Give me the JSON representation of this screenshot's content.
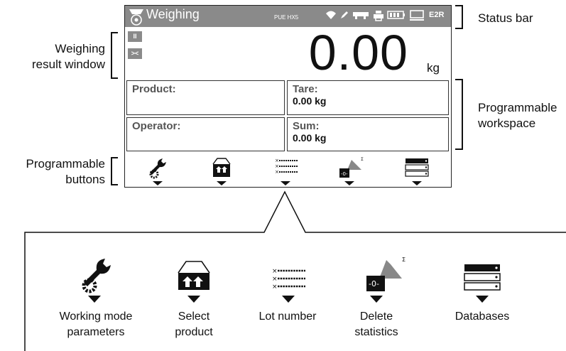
{
  "callouts": {
    "status_bar": "Status bar",
    "weighing_result_window_line1": "Weighing",
    "weighing_result_window_line2": "result window",
    "programmable_workspace_line1": "Programmable",
    "programmable_workspace_line2": "workspace",
    "programmable_buttons_line1": "Programmable",
    "programmable_buttons_line2": "buttons"
  },
  "screen": {
    "status": {
      "title": "Weighing",
      "model": "PUE HX5",
      "code": "E2R",
      "icons": [
        "weighing-mode-icon",
        "wifi-icon",
        "pen-icon",
        "scanner-icon",
        "printer-icon",
        "battery-icon",
        "computer-icon"
      ]
    },
    "small_buttons": [
      "II",
      "><"
    ],
    "weight": {
      "value": "0.00",
      "unit": "kg"
    },
    "fields": {
      "product_label": "Product:",
      "product_value": "",
      "tare_label": "Tare:",
      "tare_value": "0.00 kg",
      "operator_label": "Operator:",
      "operator_value": "",
      "sum_label": "Sum:",
      "sum_value": "0.00 kg"
    },
    "buttons": [
      "working-mode-parameters-icon",
      "select-product-icon",
      "lot-number-icon",
      "delete-statistics-icon",
      "databases-icon"
    ]
  },
  "legend": [
    {
      "icon": "working-mode-parameters-icon",
      "line1": "Working mode",
      "line2": "parameters"
    },
    {
      "icon": "select-product-icon",
      "line1": "Select",
      "line2": "product"
    },
    {
      "icon": "lot-number-icon",
      "line1": "Lot number",
      "line2": ""
    },
    {
      "icon": "delete-statistics-icon",
      "line1": "Delete",
      "line2": "statistics"
    },
    {
      "icon": "databases-icon",
      "line1": "Databases",
      "line2": ""
    }
  ]
}
